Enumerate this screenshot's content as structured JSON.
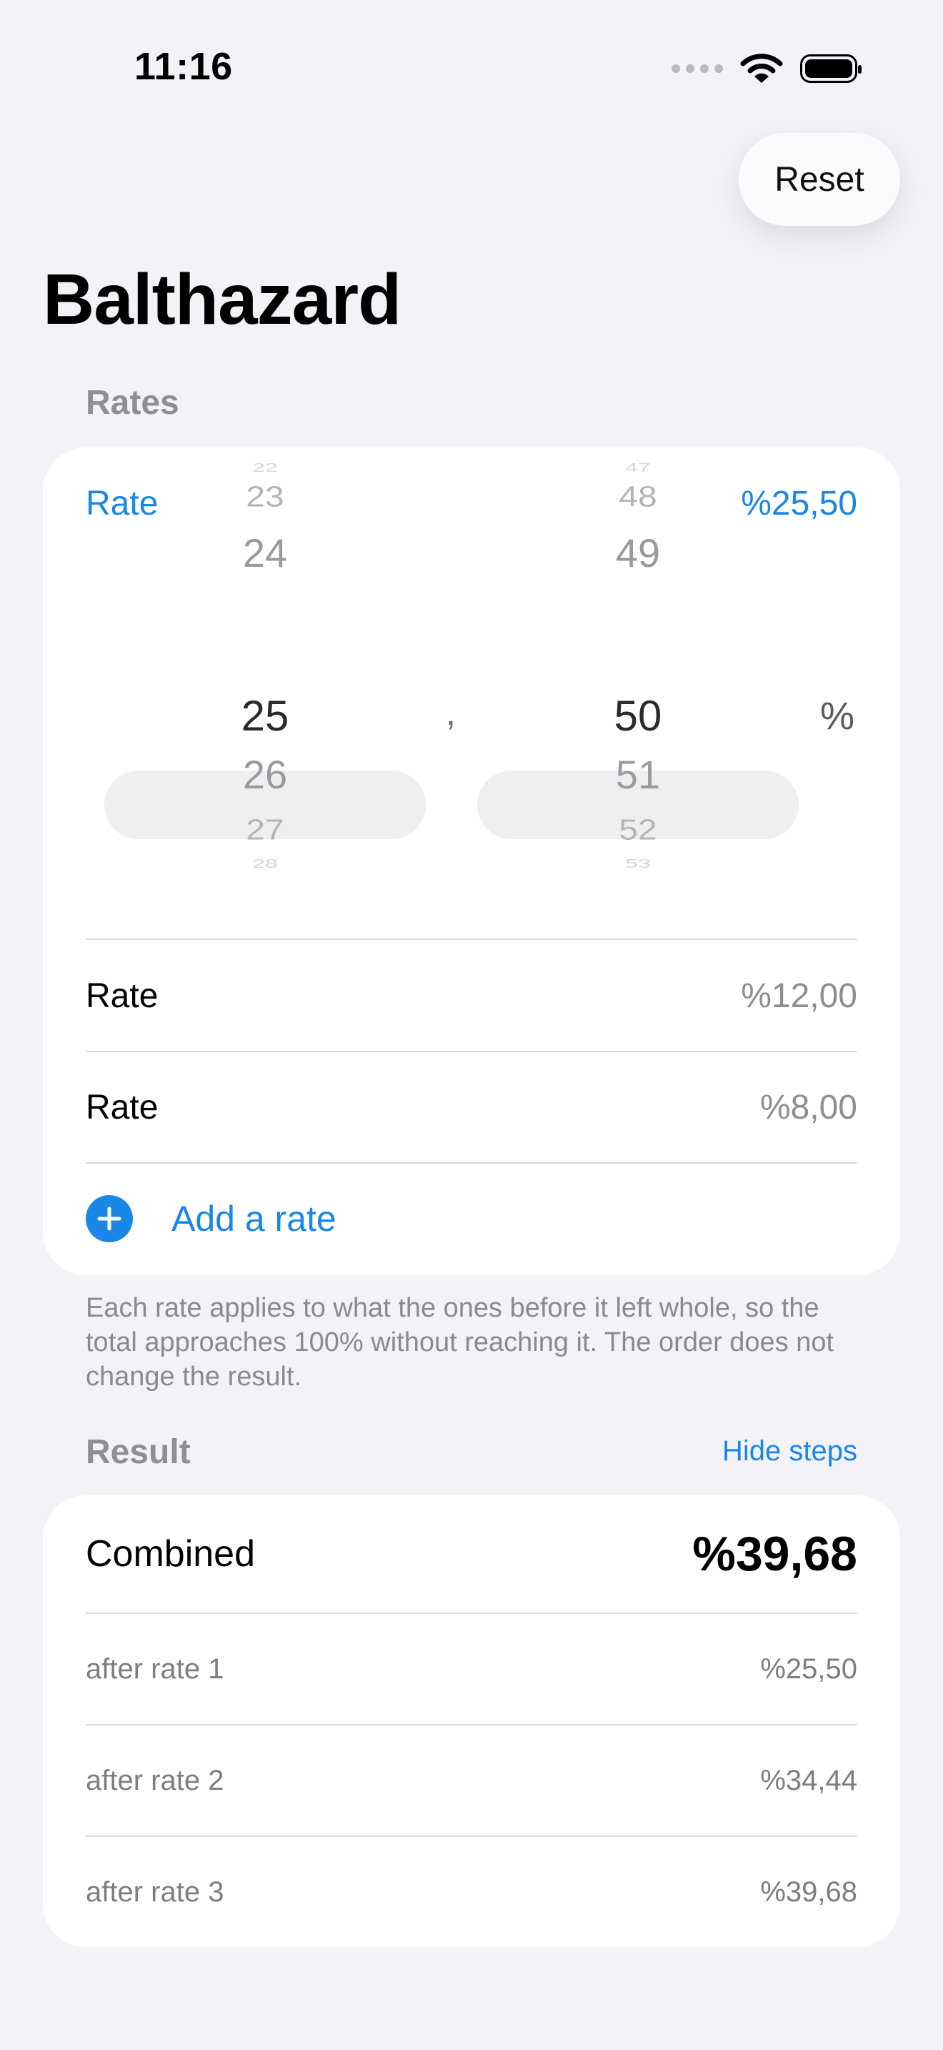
{
  "status": {
    "time": "11:16"
  },
  "header": {
    "reset_label": "Reset",
    "title": "Balthazard"
  },
  "rates_section": {
    "header": "Rates",
    "active_rate": {
      "label": "Rate",
      "value": "%25,50"
    },
    "picker": {
      "integer_column": [
        "22",
        "23",
        "24",
        "25",
        "26",
        "27",
        "28"
      ],
      "separator": ",",
      "decimal_column": [
        "47",
        "48",
        "49",
        "50",
        "51",
        "52",
        "53"
      ],
      "unit": "%"
    },
    "rates": [
      {
        "label": "Rate",
        "value": "%12,00"
      },
      {
        "label": "Rate",
        "value": "%8,00"
      }
    ],
    "add_label": "Add a rate",
    "footnote": "Each rate applies to what the ones before it left whole, so the total approaches 100% without reaching it. The order does not change the result."
  },
  "result_section": {
    "header": "Result",
    "toggle_label": "Hide steps",
    "combined_label": "Combined",
    "combined_value": "%39,68",
    "steps": [
      {
        "label": "after rate 1",
        "value": "%25,50"
      },
      {
        "label": "after rate 2",
        "value": "%34,44"
      },
      {
        "label": "after rate 3",
        "value": "%39,68"
      }
    ]
  },
  "colors": {
    "accent": "#1a86e8",
    "background": "#f2f2f7",
    "card": "#ffffff",
    "secondary_text": "#8e8e93"
  }
}
